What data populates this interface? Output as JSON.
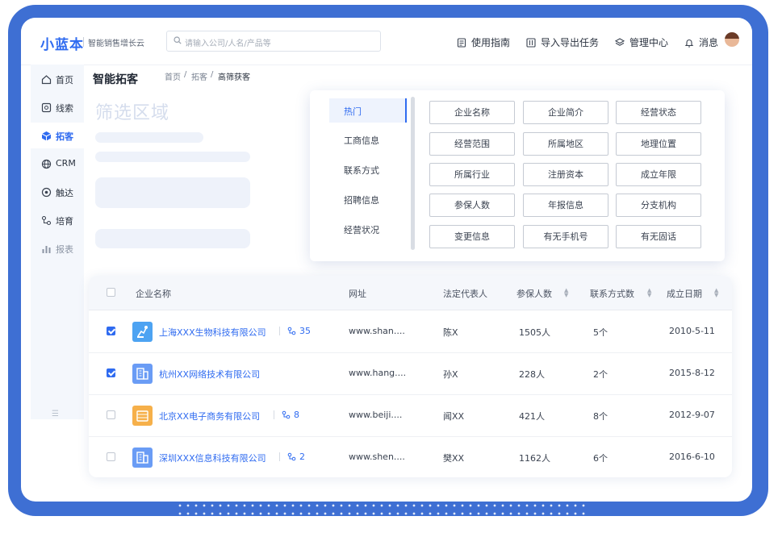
{
  "brand": {
    "logo": "小蓝本",
    "tagline": "智能销售增长云",
    "accent": "#2F6BF0",
    "frame_color": "#3E6FD3"
  },
  "search": {
    "placeholder": "请输入公司/人名/产品等"
  },
  "topnav": [
    {
      "label": "使用指南",
      "icon": "document-icon"
    },
    {
      "label": "导入导出任务",
      "icon": "import-export-icon"
    },
    {
      "label": "管理中心",
      "icon": "layers-icon"
    },
    {
      "label": "消息",
      "icon": "bell-icon"
    }
  ],
  "sidebar": {
    "items": [
      {
        "label": "首页",
        "icon": "home-icon"
      },
      {
        "label": "线索",
        "icon": "clue-icon"
      },
      {
        "label": "拓客",
        "icon": "cube-icon"
      },
      {
        "label": "CRM",
        "icon": "crm-icon"
      },
      {
        "label": "触达",
        "icon": "target-icon"
      },
      {
        "label": "培育",
        "icon": "nurture-icon"
      },
      {
        "label": "报表",
        "icon": "chart-icon"
      }
    ],
    "active_index": 2
  },
  "page": {
    "title": "智能拓客",
    "breadcrumb": [
      "首页",
      "拓客",
      "高筛获客"
    ],
    "filter_title": "筛选区域"
  },
  "filter": {
    "categories": [
      "热门",
      "工商信息",
      "联系方式",
      "招聘信息",
      "经营状况"
    ],
    "active_category": 0,
    "chips": [
      "企业名称",
      "企业简介",
      "经营状态",
      "经营范围",
      "所属地区",
      "地理位置",
      "所属行业",
      "注册资本",
      "成立年限",
      "参保人数",
      "年报信息",
      "分支机构",
      "变更信息",
      "有无手机号",
      "有无固话"
    ]
  },
  "table": {
    "headers": {
      "name": "企业名称",
      "url": "网址",
      "rep": "法定代表人",
      "insured": "参保人数",
      "contacts": "联系方式数",
      "date": "成立日期"
    },
    "rows": [
      {
        "checked": true,
        "name": "上海XXX生物科技有限公司",
        "related": "35",
        "url": "www.shan....",
        "rep": "陈X",
        "insured": "1505人",
        "contacts": "5个",
        "date": "2010-5-11",
        "logo_color": "#4DA3F2",
        "logo_icon": "robot-icon"
      },
      {
        "checked": true,
        "name": "杭州XX网络技术有限公司",
        "related": "",
        "url": "www.hang....",
        "rep": "孙X",
        "insured": "228人",
        "contacts": "2个",
        "date": "2015-8-12",
        "logo_color": "#6A9CF5",
        "logo_icon": "building-icon"
      },
      {
        "checked": false,
        "name": "北京XX电子商务有限公司",
        "related": "8",
        "url": "www.beiji....",
        "rep": "闻XX",
        "insured": "421人",
        "contacts": "8个",
        "date": "2012-9-07",
        "logo_color": "#F6B04A",
        "logo_icon": "coins-icon"
      },
      {
        "checked": false,
        "name": "深圳XXX信息科技有限公司",
        "related": "2",
        "url": "www.shen....",
        "rep": "樊XX",
        "insured": "1162人",
        "contacts": "6个",
        "date": "2016-6-10",
        "logo_color": "#6A9CF5",
        "logo_icon": "building-icon"
      }
    ]
  }
}
